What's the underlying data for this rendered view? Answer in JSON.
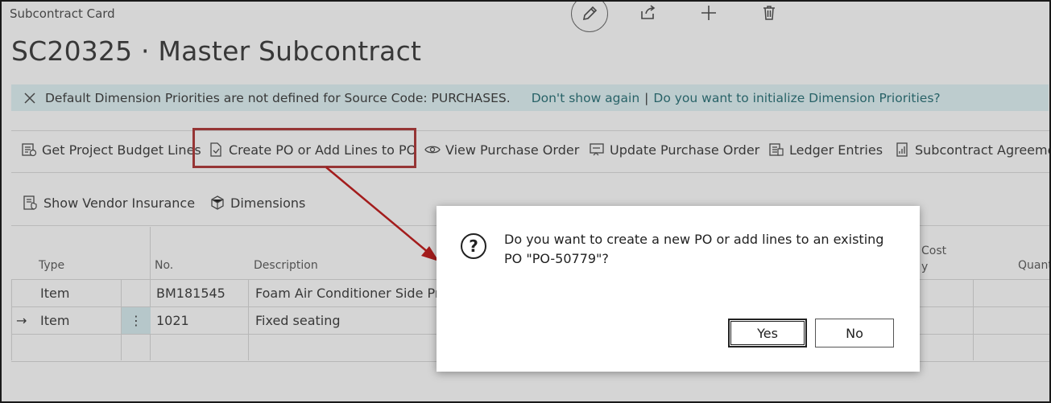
{
  "page": {
    "label": "Subcontract Card",
    "title": "SC20325 · Master Subcontract"
  },
  "top_icons": [
    "edit-icon",
    "share-icon",
    "add-icon",
    "delete-icon"
  ],
  "banner": {
    "message": "Default Dimension Priorities are not defined for Source Code: PURCHASES.",
    "dont_show": "Don't show again",
    "separator": "|",
    "initialize": "Do you want to initialize Dimension Priorities?"
  },
  "actions_row1": [
    {
      "label": "Get Project Budget Lines",
      "icon": "budget-lines-icon"
    },
    {
      "label": "Create PO or Add Lines to PO",
      "icon": "create-po-icon"
    },
    {
      "label": "View Purchase Order",
      "icon": "view-icon"
    },
    {
      "label": "Update Purchase Order",
      "icon": "update-icon"
    },
    {
      "label": "Ledger Entries",
      "icon": "ledger-icon"
    },
    {
      "label": "Subcontract Agreemen",
      "icon": "agreement-icon"
    }
  ],
  "actions_row2": [
    {
      "label": "Show Vendor Insurance",
      "icon": "insurance-icon"
    },
    {
      "label": "Dimensions",
      "icon": "dimensions-icon"
    }
  ],
  "lines": {
    "columns": {
      "type": "Type",
      "no": "No.",
      "description": "Description",
      "cost": "Cost",
      "cost2": "y",
      "quantity": "Quant"
    },
    "rows": [
      {
        "type": "Item",
        "no": "BM181545",
        "description": "Foam Air Conditioner Side Pnl"
      },
      {
        "type": "Item",
        "no": "1021",
        "description": "Fixed seating",
        "current": true
      }
    ],
    "row_menu_glyph": "⋮",
    "current_row_glyph": "→"
  },
  "dialog": {
    "question_glyph": "?",
    "text": "Do you want to create a new PO or add lines to an existing PO \"PO-50779\"?",
    "yes_label": "Yes",
    "no_label": "No"
  }
}
